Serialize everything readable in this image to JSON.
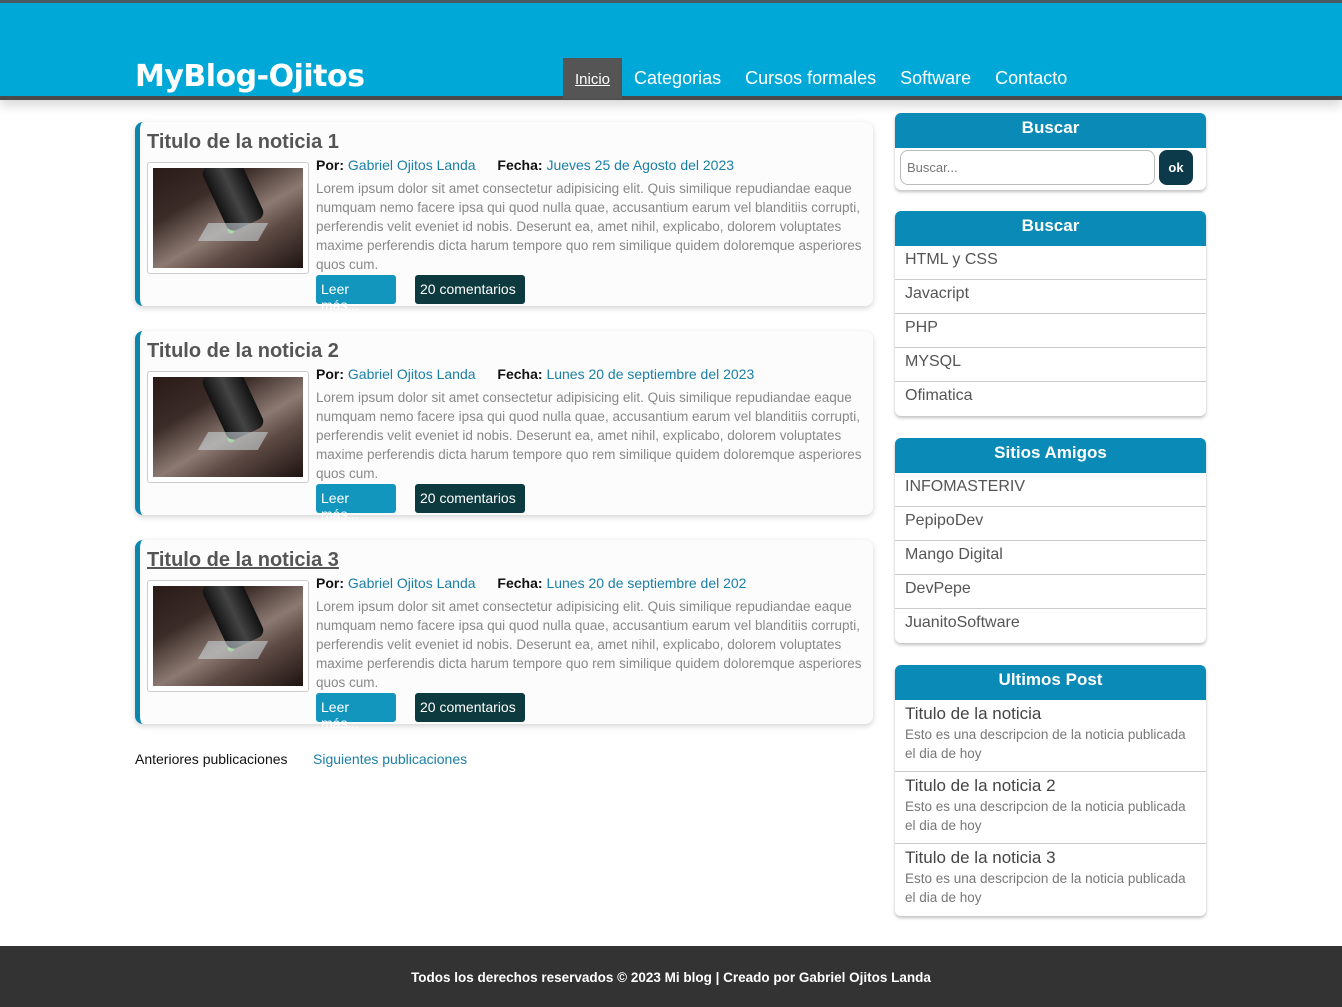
{
  "header": {
    "logo": "MyBlog-Ojitos",
    "nav": [
      "Inicio",
      "Categorias",
      "Cursos formales",
      "Software",
      "Contacto"
    ]
  },
  "posts": [
    {
      "title": "Titulo de la noticia 1",
      "by_label": "Por:",
      "author": "Gabriel Ojitos Landa",
      "date_label": "Fecha:",
      "date": "Jueves 25 de Agosto del 2023",
      "excerpt": "Lorem ipsum dolor sit amet consectetur adipisicing elit. Quis similique repudiandae eaque numquam nemo facere ipsa qui quod nulla quae, accusantium earum vel blanditiis corrupti, perferendis velit eveniet id nobis. Deserunt ea, amet nihil, explicabo, dolorem voluptates maxime perferendis dicta harum tempore quo rem similique quidem doloremque asperiores quos cum.",
      "read_more": "Leer más...",
      "comments": "20 comentarios"
    },
    {
      "title": "Titulo de la noticia 2",
      "by_label": "Por:",
      "author": "Gabriel Ojitos Landa",
      "date_label": "Fecha:",
      "date": "Lunes 20 de septiembre del 2023",
      "excerpt": "Lorem ipsum dolor sit amet consectetur adipisicing elit. Quis similique repudiandae eaque numquam nemo facere ipsa qui quod nulla quae, accusantium earum vel blanditiis corrupti, perferendis velit eveniet id nobis. Deserunt ea, amet nihil, explicabo, dolorem voluptates maxime perferendis dicta harum tempore quo rem similique quidem doloremque asperiores quos cum.",
      "read_more": "Leer más...",
      "comments": "20 comentarios"
    },
    {
      "title": "Titulo de la noticia 3",
      "by_label": "Por:",
      "author": "Gabriel Ojitos Landa",
      "date_label": "Fecha:",
      "date": "Lunes 20 de septiembre del 202",
      "excerpt": "Lorem ipsum dolor sit amet consectetur adipisicing elit. Quis similique repudiandae eaque numquam nemo facere ipsa qui quod nulla quae, accusantium earum vel blanditiis corrupti, perferendis velit eveniet id nobis. Deserunt ea, amet nihil, explicabo, dolorem voluptates maxime perferendis dicta harum tempore quo rem similique quidem doloremque asperiores quos cum.",
      "read_more": "Leer más...",
      "comments": "20 comentarios"
    }
  ],
  "pagination": {
    "prev": "Anteriores publicaciones",
    "next": "Siguientes publicaciones"
  },
  "sidebar": {
    "search": {
      "title": "Buscar",
      "placeholder": "Buscar...",
      "button": "ok"
    },
    "categories": {
      "title": "Buscar",
      "items": [
        "HTML y CSS",
        "Javacript",
        "PHP",
        "MYSQL",
        "Ofimatica"
      ]
    },
    "friends": {
      "title": "Sitios Amigos",
      "items": [
        "INFOMASTERIV",
        "PepipoDev",
        "Mango Digital",
        "DevPepe",
        "JuanitoSoftware"
      ]
    },
    "latest": {
      "title": "Ultimos Post",
      "items": [
        {
          "title": "Titulo de la noticia",
          "desc": "Esto es una descripcion de la noticia publicada el dia de hoy"
        },
        {
          "title": "Titulo de la noticia 2",
          "desc": "Esto es una descripcion de la noticia publicada el dia de hoy"
        },
        {
          "title": "Titulo de la noticia 3",
          "desc": "Esto es una descripcion de la noticia publicada el dia de hoy"
        }
      ]
    }
  },
  "footer": {
    "text": "Todos los derechos reservados © 2023 Mi blog | Creado por Gabriel Ojitos Landa"
  },
  "colors": {
    "header_bg": "#00a8d8",
    "accent": "#0a8ab6",
    "dark_button": "#0d3a3e",
    "footer_bg": "#333333"
  }
}
